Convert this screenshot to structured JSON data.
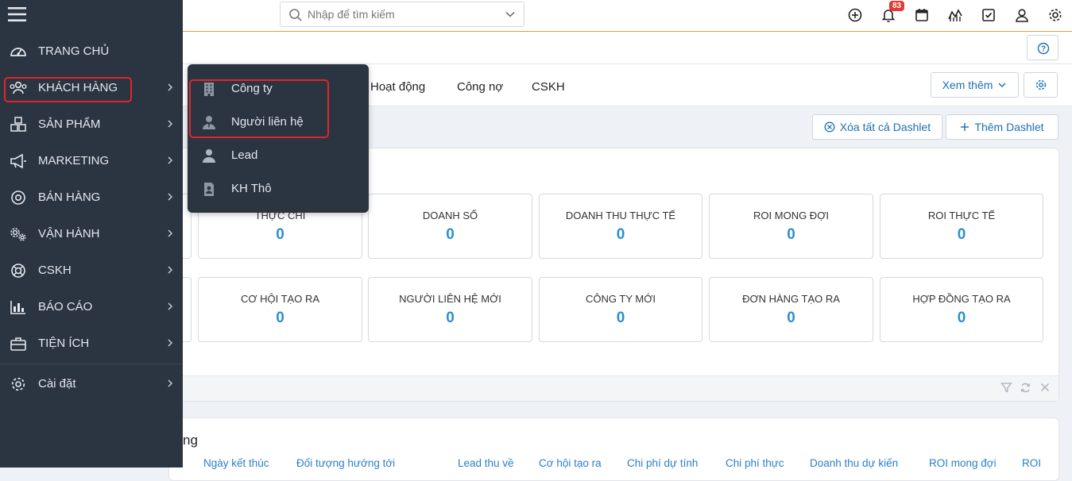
{
  "search": {
    "placeholder": "Nhập để tìm kiếm"
  },
  "header": {
    "notification_count": "83"
  },
  "tabs": [
    "Hoạt động",
    "Công nợ",
    "CSKH"
  ],
  "toolbar": {
    "more_label": "Xem thêm",
    "clear_dashlets_label": "Xóa tất cả Dashlet",
    "add_dashlet_label": "Thêm Dashlet"
  },
  "kpi_row1": [
    {
      "label": "THỰC CHI",
      "value": "0"
    },
    {
      "label": "DOANH SỐ",
      "value": "0"
    },
    {
      "label": "DOANH THU THỰC TẾ",
      "value": "0"
    },
    {
      "label": "ROI MONG ĐỢI",
      "value": "0"
    },
    {
      "label": "ROI THỰC TẾ",
      "value": "0"
    }
  ],
  "kpi_row2": [
    {
      "label": "CƠ HỘI TẠO RA",
      "value": "0"
    },
    {
      "label": "NGƯỜI LIÊN HỆ MỚI",
      "value": "0"
    },
    {
      "label": "CÔNG TY MỚI",
      "value": "0"
    },
    {
      "label": "ĐƠN HÀNG TẠO RA",
      "value": "0"
    },
    {
      "label": "HỢP ĐỒNG TẠO RA",
      "value": "0"
    }
  ],
  "panel2": {
    "title_fragment": "ng",
    "columns": [
      "Ngày kết thúc",
      "Đối tượng hướng tới",
      "Lead thu về",
      "Cơ hội tạo ra",
      "Chi phí dự tính",
      "Chi phí thực",
      "Doanh thu dự kiến",
      "ROI mong đợi",
      "ROI"
    ]
  },
  "sidebar": {
    "items": [
      {
        "label": "TRANG CHỦ"
      },
      {
        "label": "KHÁCH HÀNG"
      },
      {
        "label": "SẢN PHẨM"
      },
      {
        "label": "MARKETING"
      },
      {
        "label": "BÁN HÀNG"
      },
      {
        "label": "VẬN HÀNH"
      },
      {
        "label": "CSKH"
      },
      {
        "label": "BÁO CÁO"
      },
      {
        "label": "TIỆN ÍCH"
      },
      {
        "label": "Cài đặt"
      }
    ]
  },
  "flyout": {
    "items": [
      {
        "label": "Công ty"
      },
      {
        "label": "Người liên hệ"
      },
      {
        "label": "Lead"
      },
      {
        "label": "KH Thô"
      }
    ]
  },
  "colors": {
    "sidebar_bg": "#2b3441",
    "accent_blue": "#2a8fd0",
    "highlight_red": "#e0262b",
    "badge_red": "#e53935"
  }
}
